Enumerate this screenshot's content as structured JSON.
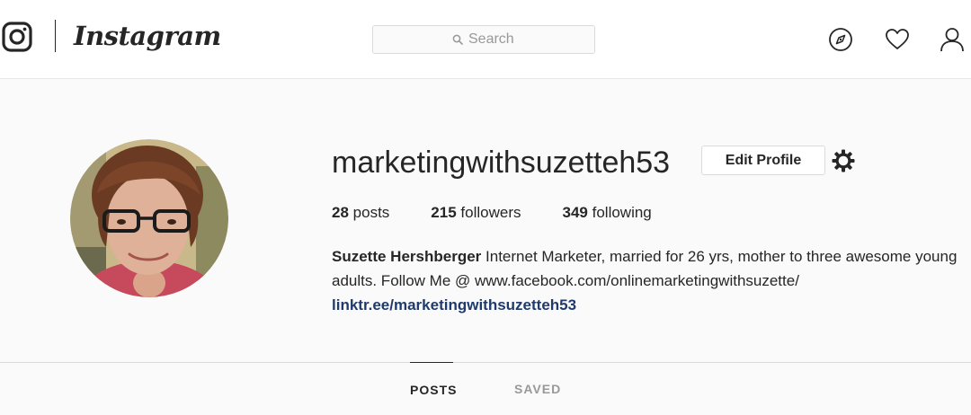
{
  "header": {
    "wordmark": "Instagram",
    "search_placeholder": "Search",
    "icons": [
      "instagram-glyph-icon",
      "search-icon",
      "compass-icon",
      "heart-icon",
      "profile-icon"
    ]
  },
  "profile": {
    "username": "marketingwithsuzetteh53",
    "edit_label": "Edit Profile",
    "stats": {
      "posts_count": "28",
      "posts_label": "posts",
      "followers_count": "215",
      "followers_label": "followers",
      "following_count": "349",
      "following_label": "following"
    },
    "bio": {
      "full_name": "Suzette Hershberger",
      "text": "Internet Marketer, married for 26 yrs, mother to three awesome young adults. Follow Me @ www.facebook.com/onlinemarketingwithsuzette/",
      "link": "linktr.ee/marketingwithsuzetteh53"
    }
  },
  "tabs": {
    "posts": "POSTS",
    "saved": "SAVED",
    "active": "POSTS"
  },
  "colors": {
    "background": "#fafafa",
    "text": "#262626",
    "muted": "#999999",
    "border": "#dbdbdb",
    "link": "#1f3a6b"
  }
}
